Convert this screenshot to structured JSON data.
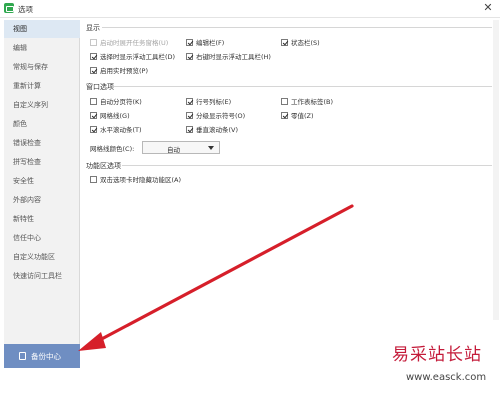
{
  "window": {
    "title": "选项",
    "close_glyph": "✕"
  },
  "sidebar": {
    "items": [
      {
        "label": "视图",
        "active": true
      },
      {
        "label": "编辑"
      },
      {
        "label": "常规与保存"
      },
      {
        "label": "重新计算"
      },
      {
        "label": "自定义序列"
      },
      {
        "label": "颜色"
      },
      {
        "label": "错误检查"
      },
      {
        "label": "拼写检查"
      },
      {
        "label": "安全性"
      },
      {
        "label": "外部内容"
      },
      {
        "label": "新特性"
      },
      {
        "label": "信任中心"
      },
      {
        "label": "自定义功能区"
      },
      {
        "label": "快速访问工具栏"
      }
    ],
    "backup_button": "备份中心"
  },
  "display": {
    "title": "显示",
    "options": [
      {
        "label": "启动时展开任务窗格(U)",
        "checked": false,
        "disabled": true
      },
      {
        "label": "编辑栏(F)",
        "checked": true
      },
      {
        "label": "状态栏(S)",
        "checked": true
      },
      {
        "label": "选择时显示浮动工具栏(D)",
        "checked": true
      },
      {
        "label": "右键时显示浮动工具栏(H)",
        "checked": true
      },
      {
        "label": "启用实时预览(P)",
        "checked": true
      }
    ]
  },
  "window_options": {
    "title": "窗口选项",
    "options": [
      {
        "label": "自动分页符(K)",
        "checked": false
      },
      {
        "label": "行号列标(E)",
        "checked": true
      },
      {
        "label": "工作表标签(B)",
        "checked": false
      },
      {
        "label": "网格线(G)",
        "checked": true
      },
      {
        "label": "分级显示符号(O)",
        "checked": true
      },
      {
        "label": "零值(Z)",
        "checked": true
      },
      {
        "label": "水平滚动条(T)",
        "checked": true
      },
      {
        "label": "垂直滚动条(V)",
        "checked": true
      }
    ],
    "grid_color_label": "网格线颜色(C):",
    "grid_color_value": "自动"
  },
  "ribbon_options": {
    "title": "功能区选项",
    "options": [
      {
        "label": "双击选项卡时隐藏功能区(A)",
        "checked": false
      }
    ]
  },
  "watermark": {
    "text": "易采站长站",
    "url": "www.easck.com"
  },
  "colors": {
    "accent_red": "#d61f2a",
    "backup_button_bg": "#6f8ec2",
    "sidebar_active": "#dde8f3"
  },
  "icons": [
    "app-icon",
    "close-icon",
    "backup-icon",
    "checkbox",
    "chevron-down-icon",
    "red-arrow"
  ]
}
